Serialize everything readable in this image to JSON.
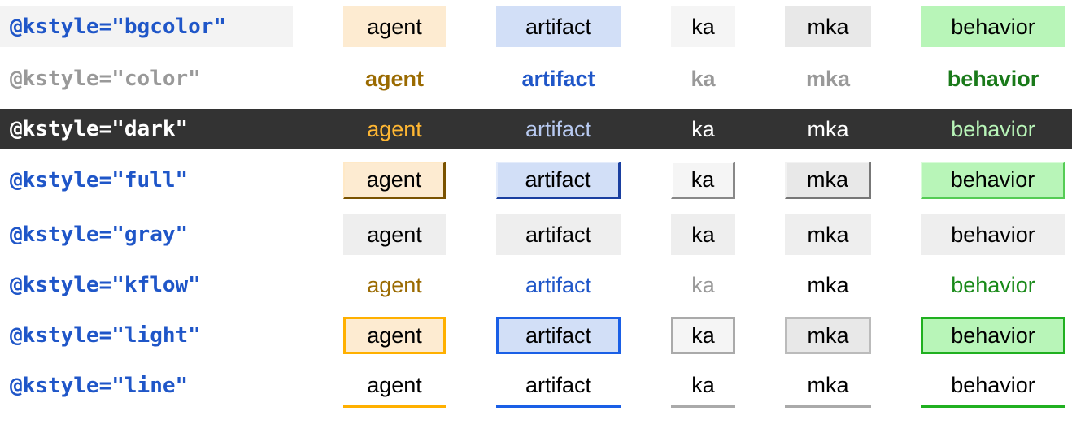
{
  "rows": [
    {
      "prefix": "@",
      "name": "kstyle=\"bgcolor\"",
      "style": "bgcolor",
      "labels": [
        "agent",
        "artifact",
        "ka",
        "mka",
        "behavior"
      ]
    },
    {
      "prefix": "@",
      "name": "kstyle=\"color\"",
      "style": "color",
      "labels": [
        "agent",
        "artifact",
        "ka",
        "mka",
        "behavior"
      ]
    },
    {
      "prefix": "@",
      "name": "kstyle=\"dark\"",
      "style": "dark",
      "labels": [
        "agent",
        "artifact",
        "ka",
        "mka",
        "behavior"
      ]
    },
    {
      "prefix": "@",
      "name": "kstyle=\"full\"",
      "style": "full",
      "labels": [
        "agent",
        "artifact",
        "ka",
        "mka",
        "behavior"
      ]
    },
    {
      "prefix": "@",
      "name": "kstyle=\"gray\"",
      "style": "gray",
      "labels": [
        "agent",
        "artifact",
        "ka",
        "mka",
        "behavior"
      ]
    },
    {
      "prefix": "@",
      "name": "kstyle=\"kflow\"",
      "style": "kflow",
      "labels": [
        "agent",
        "artifact",
        "ka",
        "mka",
        "behavior"
      ]
    },
    {
      "prefix": "@",
      "name": "kstyle=\"light\"",
      "style": "light",
      "labels": [
        "agent",
        "artifact",
        "ka",
        "mka",
        "behavior"
      ]
    },
    {
      "prefix": "@",
      "name": "kstyle=\"line\"",
      "style": "line",
      "labels": [
        "agent",
        "artifact",
        "ka",
        "mka",
        "behavior"
      ]
    }
  ],
  "colors": {
    "code_blue": "#1f56c8",
    "agent_bg": "#fdebd1",
    "artifact_bg": "#d2dff7",
    "ka_bg": "#f5f5f5",
    "mka_bg": "#e8e8e8",
    "behavior_bg": "#b8f5b8",
    "agent_fg": "#9a6a00",
    "artifact_fg": "#1f56c8",
    "ka_fg": "#999999",
    "mka_fg": "#999999",
    "behavior_fg": "#1a7a1a",
    "dark_bg": "#333333",
    "dark_agent": "#ffb733",
    "dark_artifact": "#b7c9f0",
    "dark_behavior": "#b8f5b8",
    "agent_line": "#ffb000",
    "artifact_line": "#1a5fe6",
    "ka_line": "#aaaaaa",
    "mka_line": "#aaaaaa",
    "behavior_line": "#20b020"
  }
}
